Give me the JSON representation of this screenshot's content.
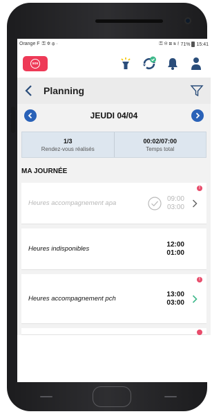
{
  "status_bar": {
    "carrier": "Orange F",
    "left_icons": "⚿ ✲ ⊕ ·",
    "right_icons": "⚿ ✻ ⊠ ≋ ⌇",
    "battery": "71%",
    "time": "15:41"
  },
  "header": {
    "sos_label": "sos",
    "icons": [
      "flashlight-icon",
      "sync-check-icon",
      "bell-icon",
      "user-icon"
    ]
  },
  "nav": {
    "title": "Planning",
    "back_icon": "chevron-left-icon",
    "filter_icon": "filter-icon"
  },
  "day": {
    "label": "JEUDI 04/04"
  },
  "stats": [
    {
      "value": "1/3",
      "label": "Rendez-vous réalisés"
    },
    {
      "value": "00:02/07:00",
      "label": "Temps total"
    }
  ],
  "section_title": "MA JOURNÉE",
  "appointments": [
    {
      "title": "Heures accompagnement apa",
      "start": "09:00",
      "duration": "03:00",
      "done": true,
      "alert": true
    },
    {
      "title": "Heures indisponibles",
      "start": "12:00",
      "duration": "01:00",
      "done": false,
      "alert": false
    },
    {
      "title": "Heures accompagnement pch",
      "start": "13:00",
      "duration": "03:00",
      "done": false,
      "alert": true
    }
  ],
  "colors": {
    "sos_red": "#ee3a57",
    "accent_blue": "#2a62b8",
    "chevron_green": "#3fb98b",
    "alert_pink": "#e84c6b",
    "stats_bg": "#dde6ef"
  }
}
